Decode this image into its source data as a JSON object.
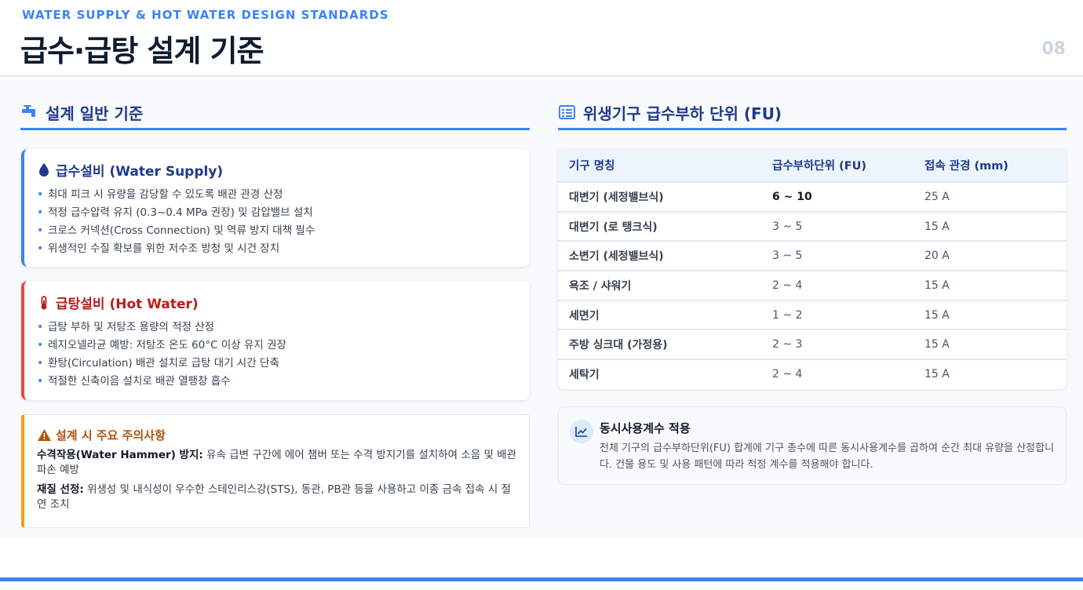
{
  "header": {
    "eyebrow": "WATER SUPPLY & HOT WATER DESIGN STANDARDS",
    "title": "급수·급탕 설계 기준",
    "page_number": "08"
  },
  "left": {
    "section_title": "설계 일반 기준",
    "section_icon": "faucet-icon",
    "water_supply": {
      "title": "급수설비 (Water Supply)",
      "icon": "water-drop-icon",
      "items": [
        "최대 피크 시 유량을 감당할 수 있도록 배관 관경 산정",
        "적정 급수압력 유지 (0.3~0.4 MPa 권장) 및 감압밸브 설치",
        "크로스 커넥션(Cross Connection) 및 역류 방지 대책 필수",
        "위생적인 수질 확보를 위한 저수조 방청 및 시건 장치"
      ]
    },
    "hot_water": {
      "title": "급탕설비 (Hot Water)",
      "icon": "thermometer-icon",
      "items": [
        "급탕 부하 및 저탕조 용량의 적정 산정",
        "레지오넬라균 예방: 저탕조 온도 60°C 이상 유지 권장",
        "환탕(Circulation) 배관 설치로 급탕 대기 시간 단축",
        "적절한 신축이음 설치로 배관 열팽창 흡수"
      ]
    },
    "caution": {
      "title": "설계 시 주요 주의사항",
      "icon": "warning-icon",
      "items": [
        {
          "label": "수격작용(Water Hammer) 방지:",
          "text": " 유속 급변 구간에 에어 챔버 또는 수격 방지기를 설치하여 소음 및 배관 파손 예방"
        },
        {
          "label": "재질 선정:",
          "text": " 위생성 및 내식성이 우수한 스테인리스강(STS), 동관, PB관 등을 사용하고 이종 금속 접속 시 절연 조치"
        }
      ]
    }
  },
  "right": {
    "section_title": "위생기구 급수부하 단위 (FU)",
    "section_icon": "table-list-icon",
    "table": {
      "headers": [
        "기구 명칭",
        "급수부하단위 (FU)",
        "접속 관경 (mm)"
      ],
      "rows": [
        [
          "대변기 (세정밸브식)",
          "6 ~ 10",
          "25 A"
        ],
        [
          "대변기 (로 탱크식)",
          "3 ~ 5",
          "15 A"
        ],
        [
          "소변기 (세정밸브식)",
          "3 ~ 5",
          "20 A"
        ],
        [
          "욕조 / 샤워기",
          "2 ~ 4",
          "15 A"
        ],
        [
          "세면기",
          "1 ~ 2",
          "15 A"
        ],
        [
          "주방 싱크대 (가정용)",
          "2 ~ 3",
          "15 A"
        ],
        [
          "세탁기",
          "2 ~ 4",
          "15 A"
        ]
      ]
    },
    "info": {
      "icon": "line-chart-icon",
      "title": "동시사용계수 적용",
      "text": "전체 기구의 급수부하단위(FU) 합계에 기구 총수에 따른 동시사용계수를 곱하여 순간 최대 유량을 산정합니다. 건물 용도 및 사용 패턴에 따라 적정 계수를 적용해야 합니다."
    }
  },
  "colors": {
    "accent": "#3b82f6",
    "title_navy": "#1e3a8a",
    "supply_blue": "#1e3a8a",
    "hot_red": "#b91c1c",
    "warning_amber": "#f59e0b",
    "warning_text": "#b45309"
  }
}
